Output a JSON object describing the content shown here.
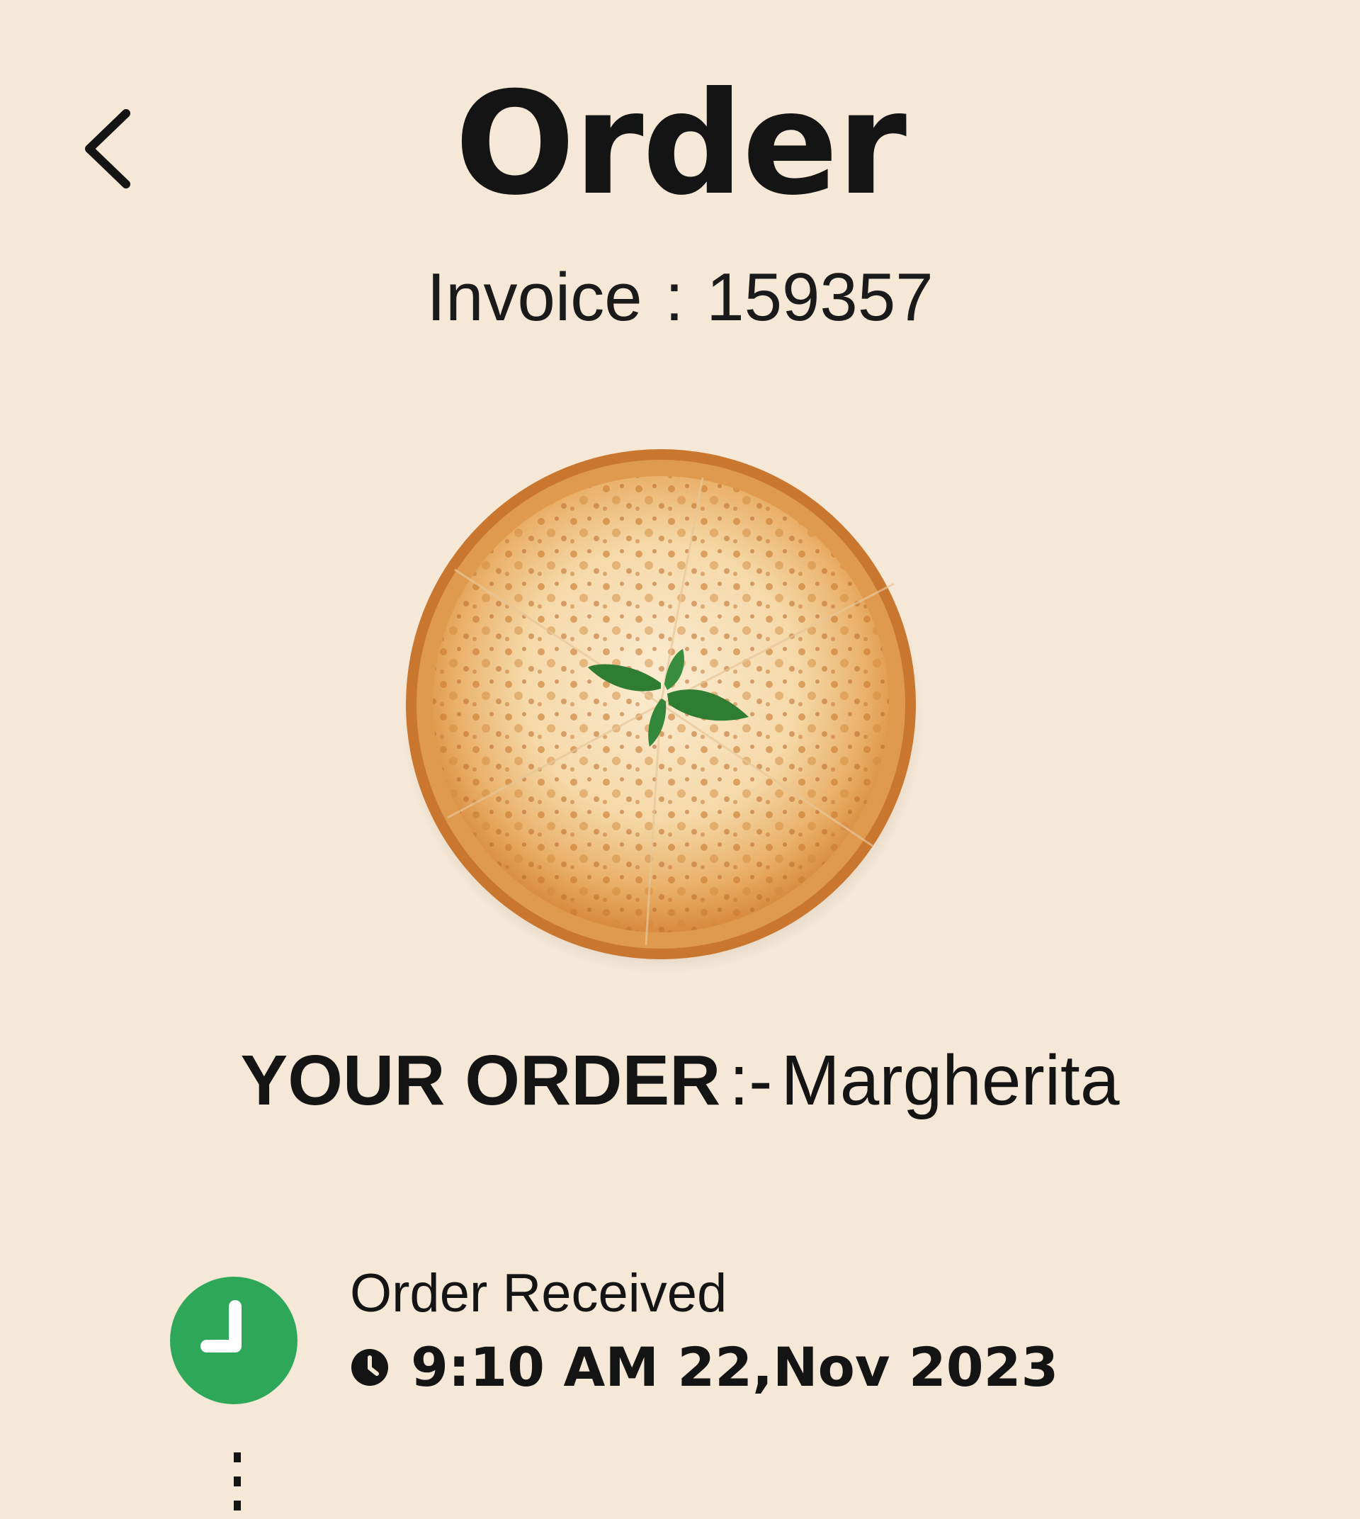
{
  "header": {
    "title": "Order",
    "back_icon": "chevron-left-icon"
  },
  "invoice": {
    "label": "Invoice",
    "separator": ":",
    "number": "159357"
  },
  "product": {
    "image": "margherita-pizza-photo"
  },
  "order": {
    "label": "YOUR ORDER",
    "separator": ":-",
    "item": "Margherita"
  },
  "timeline": {
    "steps": [
      {
        "title": "Order Received",
        "time": "9:10 AM 22,Nov 2023",
        "icon": "clock-icon",
        "color": "#2ea75b"
      }
    ]
  },
  "colors": {
    "background": "#f5e8d7",
    "text": "#141414",
    "accent": "#2ea75b"
  }
}
